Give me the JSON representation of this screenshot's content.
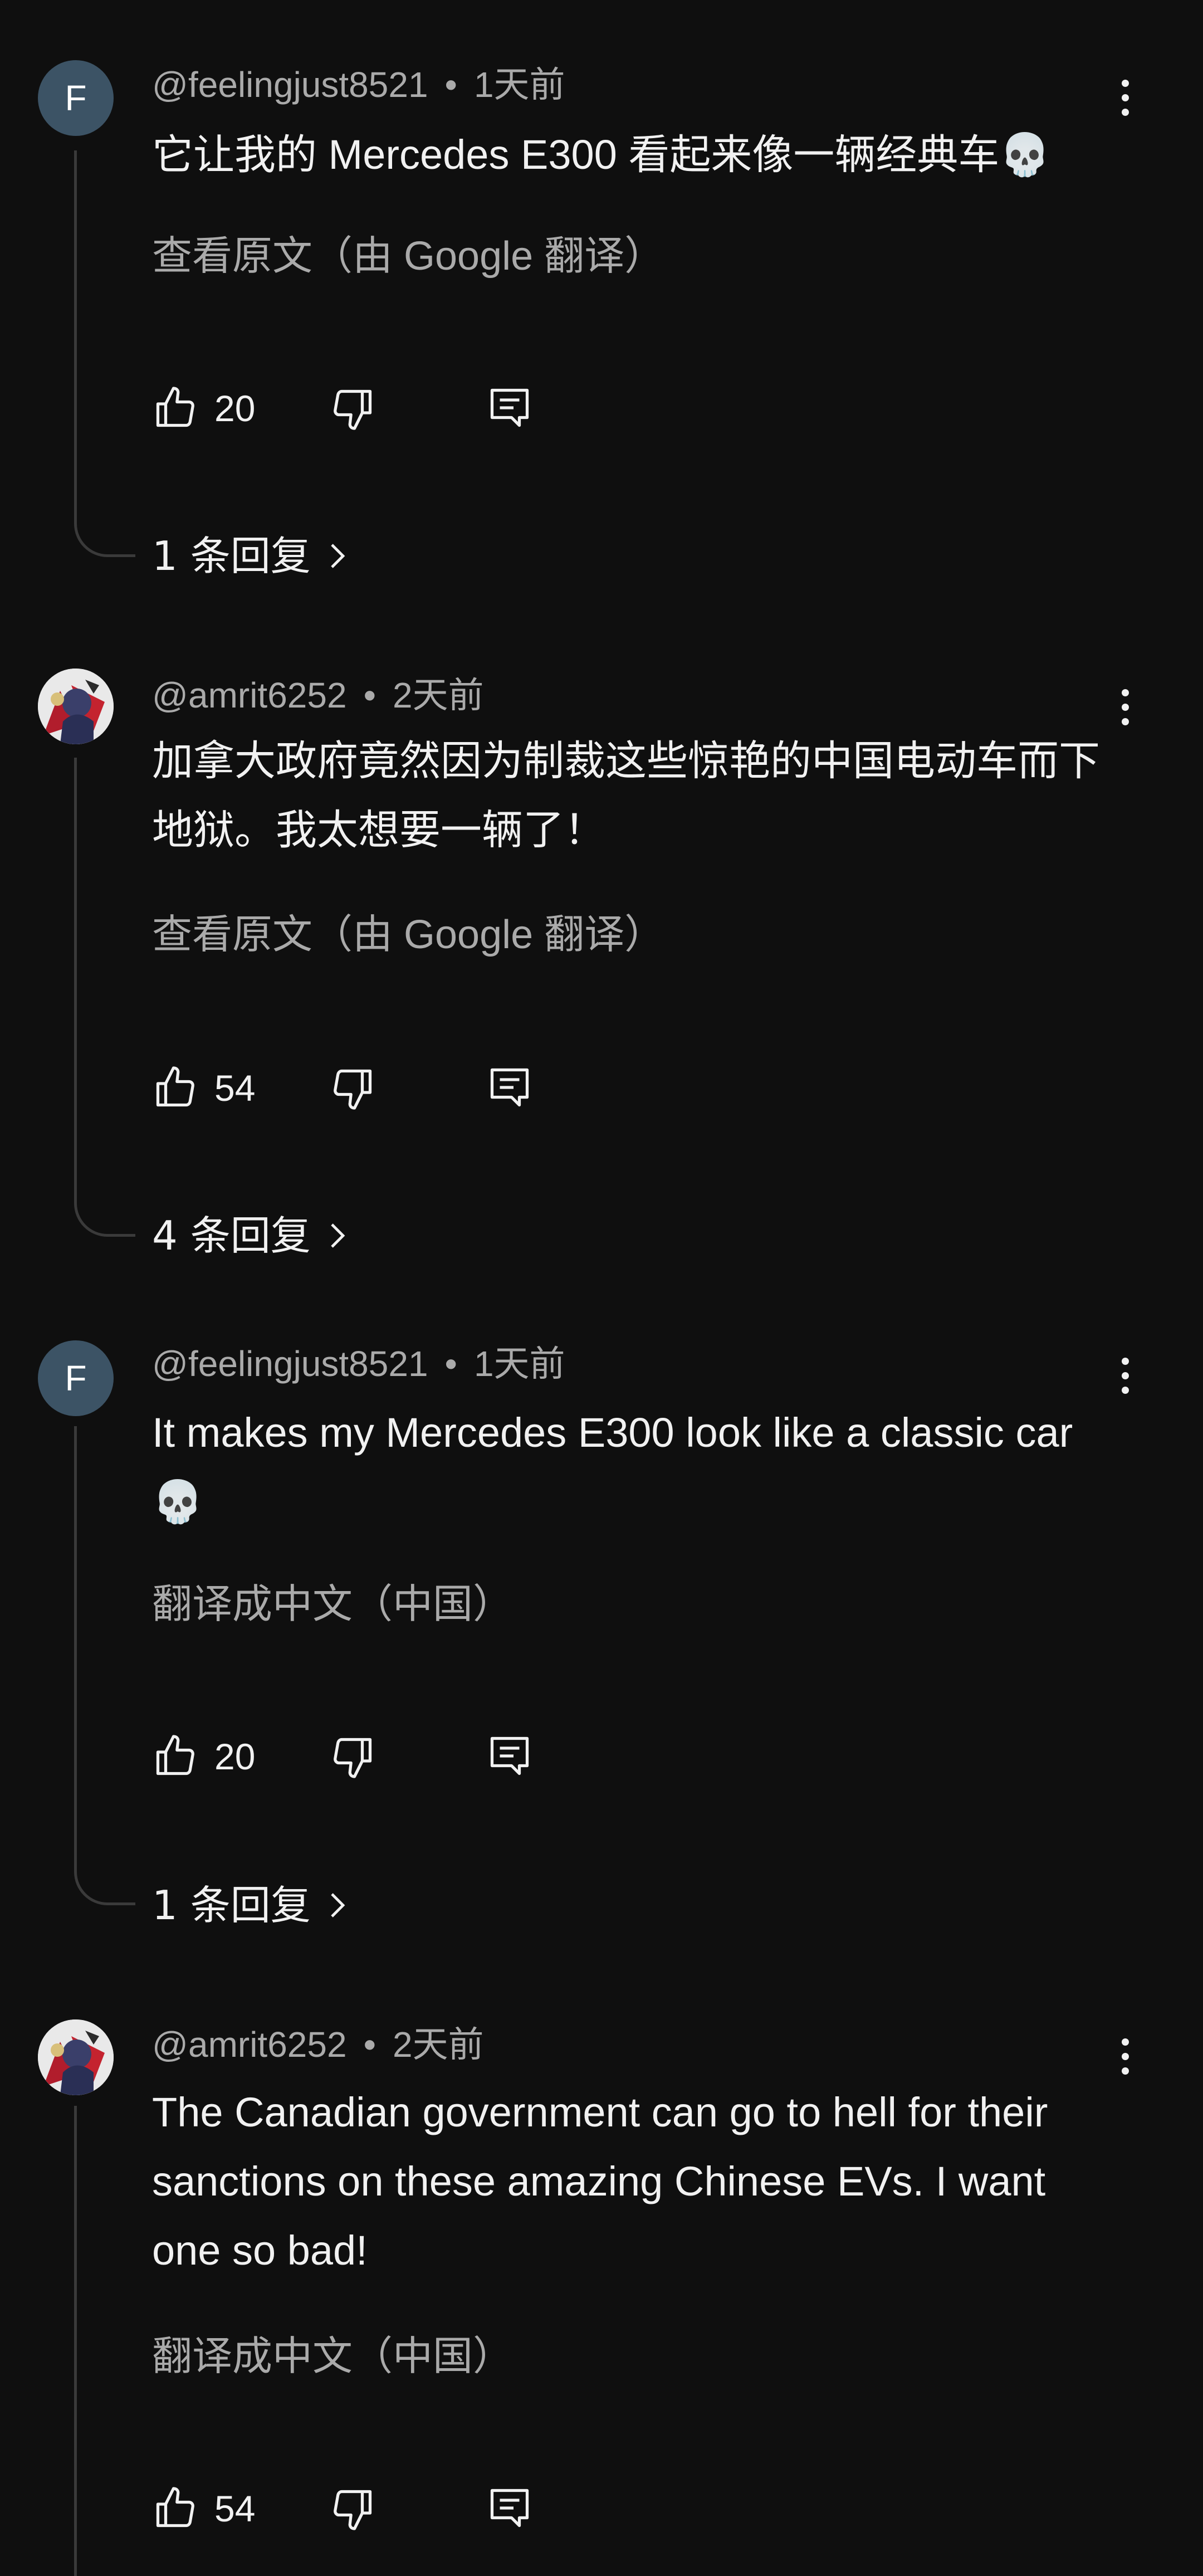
{
  "comments": [
    {
      "avatar_letter": "F",
      "author": "@feelingjust8521",
      "time": "1天前",
      "text": "它让我的 Mercedes E300 看起来像一辆经典车💀",
      "translate_label": "查看原文（由 Google 翻译）",
      "likes": "20",
      "replies_label": "1 条回复"
    },
    {
      "avatar_letter": "",
      "author": "@amrit6252",
      "time": "2天前",
      "text": "加拿大政府竟然因为制裁这些惊艳的中国电动车而下地狱。我太想要一辆了！",
      "translate_label": "查看原文（由 Google 翻译）",
      "likes": "54",
      "replies_label": "4 条回复"
    },
    {
      "avatar_letter": "F",
      "author": "@feelingjust8521",
      "time": "1天前",
      "text": "It makes my Mercedes E300 look like a classic car💀",
      "translate_label": "翻译成中文（中国）",
      "likes": "20",
      "replies_label": "1 条回复"
    },
    {
      "avatar_letter": "",
      "author": "@amrit6252",
      "time": "2天前",
      "text": "The Canadian government can go to hell for their sanctions on these amazing Chinese EVs. I want one so bad!",
      "translate_label": "翻译成中文（中国）",
      "likes": "54",
      "replies_label": ""
    }
  ],
  "separator": "•",
  "icons": {
    "like": "thumbs-up-icon",
    "dislike": "thumbs-down-icon",
    "reply": "reply-comment-icon",
    "more": "more-vertical-icon",
    "chevron": "chevron-right-icon"
  },
  "colors": {
    "background": "#0f0f0f",
    "text": "#f1f1f1",
    "secondary": "#aaaaaa",
    "avatar_letter_bg": "#3c5365"
  }
}
